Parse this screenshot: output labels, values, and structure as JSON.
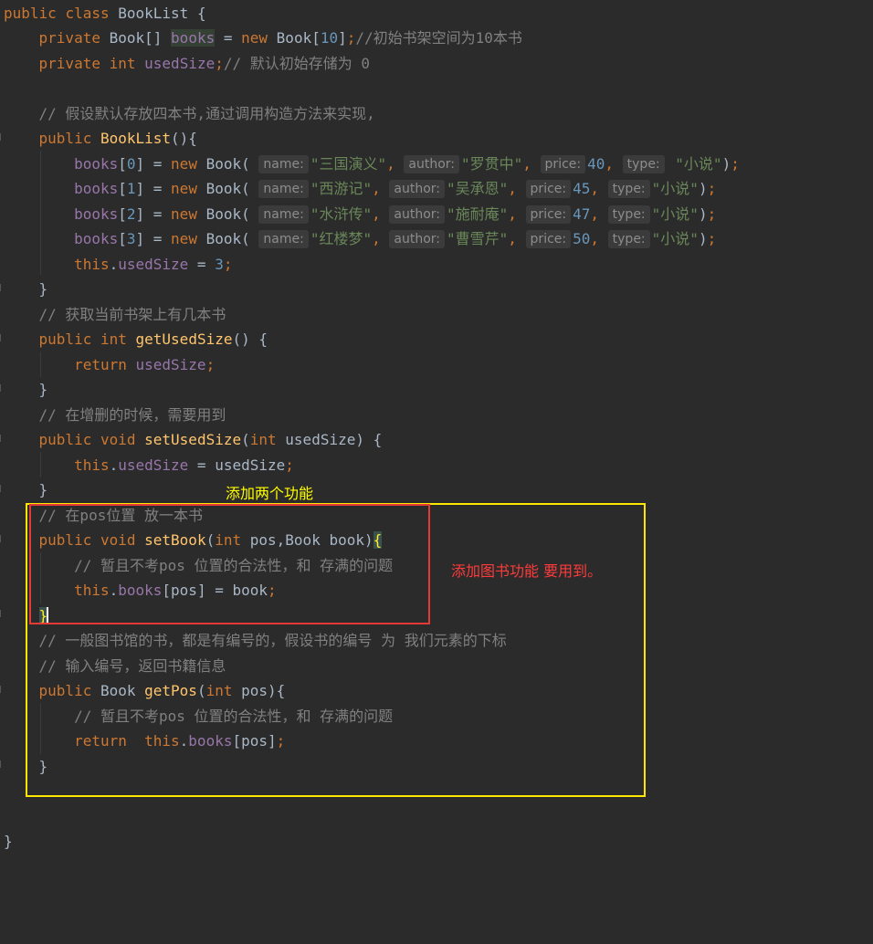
{
  "code": {
    "class_decl": {
      "kw_public": "public",
      "kw_class": "class",
      "name": "BookList",
      "brace": " {"
    },
    "field_books": {
      "kw_private": "private",
      "type": "Book[]",
      "name": "books",
      "eq": " = ",
      "kw_new": "new",
      "ctor": "Book[",
      "size": "10",
      "close": "]",
      "semi": ";",
      "comment": "//初始书架空间为10本书"
    },
    "field_used": {
      "kw_private": "private",
      "kw_int": "int",
      "name": "usedSize",
      "semi": ";",
      "comment": "// 默认初始存储为 0"
    },
    "ctor_comment": "// 假设默认存放四本书,通过调用构造方法来实现,",
    "ctor_decl": {
      "kw_public": "public",
      "name": "BookList",
      "rest": "(){"
    },
    "hint_labels": {
      "name": "name:",
      "author": "author:",
      "price": "price:",
      "type": "type:"
    },
    "books_init": [
      {
        "index": "0",
        "name": "\"三国演义\"",
        "author": "\"罗贯中\"",
        "price": "40",
        "type": "\"小说\""
      },
      {
        "index": "1",
        "name": "\"西游记\"",
        "author": "\"吴承恩\"",
        "price": "45",
        "type": "\"小说\""
      },
      {
        "index": "2",
        "name": "\"水浒传\"",
        "author": "\"施耐庵\"",
        "price": "47",
        "type": "\"小说\""
      },
      {
        "index": "3",
        "name": "\"红楼梦\"",
        "author": "\"曹雪芹\"",
        "price": "50",
        "type": "\"小说\""
      }
    ],
    "used_assign": {
      "kw_this": "this",
      "field": "usedSize",
      "eq": " = ",
      "value": "3",
      "semi": ";"
    },
    "close_brace": "}",
    "get_comment": "// 获取当前书架上有几本书",
    "get_decl": {
      "kw_public": "public",
      "kw_int": "int",
      "name": "getUsedSize",
      "rest": "() {"
    },
    "get_return": {
      "kw_return": "return",
      "field": "usedSize",
      "semi": ";"
    },
    "set_comment": "// 在增删的时候，需要用到",
    "set_decl": {
      "kw_public": "public",
      "kw_void": "void",
      "name": "setUsedSize",
      "open": "(",
      "kw_int": "int",
      "rest": " usedSize) {"
    },
    "set_assign": {
      "kw_this": "this",
      "field": "usedSize",
      "rest": " = usedSize",
      "semi": ";"
    },
    "setbook_comment": "// 在pos位置 放一本书",
    "setbook_decl": {
      "kw_public": "public",
      "kw_void": "void",
      "name": "setBook",
      "open": "(",
      "kw_int": "int",
      "rest": " pos,Book book)",
      "brace": "{"
    },
    "setbook_note": "// 暂且不考pos 位置的合法性，和 存满的问题",
    "setbook_assign": {
      "kw_this": "this",
      "field": "books",
      "rest": "[pos] = book",
      "semi": ";"
    },
    "setbook_close": "}",
    "getpos_comment1": "// 一般图书馆的书，都是有编号的，假设书的编号 为 我们元素的下标",
    "getpos_comment2": "// 输入编号，返回书籍信息",
    "getpos_decl": {
      "kw_public": "public",
      "type": "Book",
      "name": "getPos",
      "open": "(",
      "kw_int": "int",
      "rest": " pos){"
    },
    "getpos_note": "// 暂且不考pos 位置的合法性，和 存满的问题",
    "getpos_return": {
      "kw_return": "return",
      "kw_this": "this",
      "field": "books",
      "rest": "[pos]",
      "semi": ";"
    },
    "class_close": "}"
  },
  "annotations": {
    "two_features": "添加两个功能",
    "add_book_use": "添加图书功能 要用到。"
  },
  "colors": {
    "background": "#2b2b2b",
    "keyword": "#cc7832",
    "field": "#9876aa",
    "function": "#ffc66d",
    "number": "#6897bb",
    "string": "#6a8759",
    "comment": "#808080",
    "yellow_box": "#ffe600",
    "red_box": "#e53935"
  }
}
